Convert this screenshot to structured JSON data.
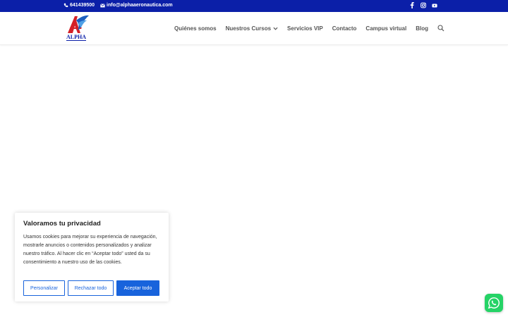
{
  "topbar": {
    "phone": "641439500",
    "email": "info@alphaaeronautica.com",
    "social_icons": [
      "facebook-icon",
      "instagram-icon",
      "youtube-icon"
    ]
  },
  "header": {
    "logo_text": "ALPHA",
    "nav": [
      {
        "label": "Quiénes somos"
      },
      {
        "label": "Nuestros Cursos"
      },
      {
        "label": "Servicios VIP"
      },
      {
        "label": "Contacto"
      },
      {
        "label": "Campus virtual"
      },
      {
        "label": "Blog"
      }
    ]
  },
  "cookie": {
    "title": "Valoramos tu privacidad",
    "body": "Usamos cookies para mejorar su experiencia de navegación, mostrarle anuncios o contenidos personalizados y analizar nuestro tráfico. Al hacer clic en “Aceptar todo” usted da su consentimiento a nuestro uso de las cookies.",
    "customize_label": "Personalizar",
    "reject_label": "Rechazar todo",
    "accept_label": "Aceptar todo"
  },
  "colors": {
    "topbar": "#0b1fa8",
    "accent": "#1863dc",
    "whatsapp": "#25d366"
  }
}
